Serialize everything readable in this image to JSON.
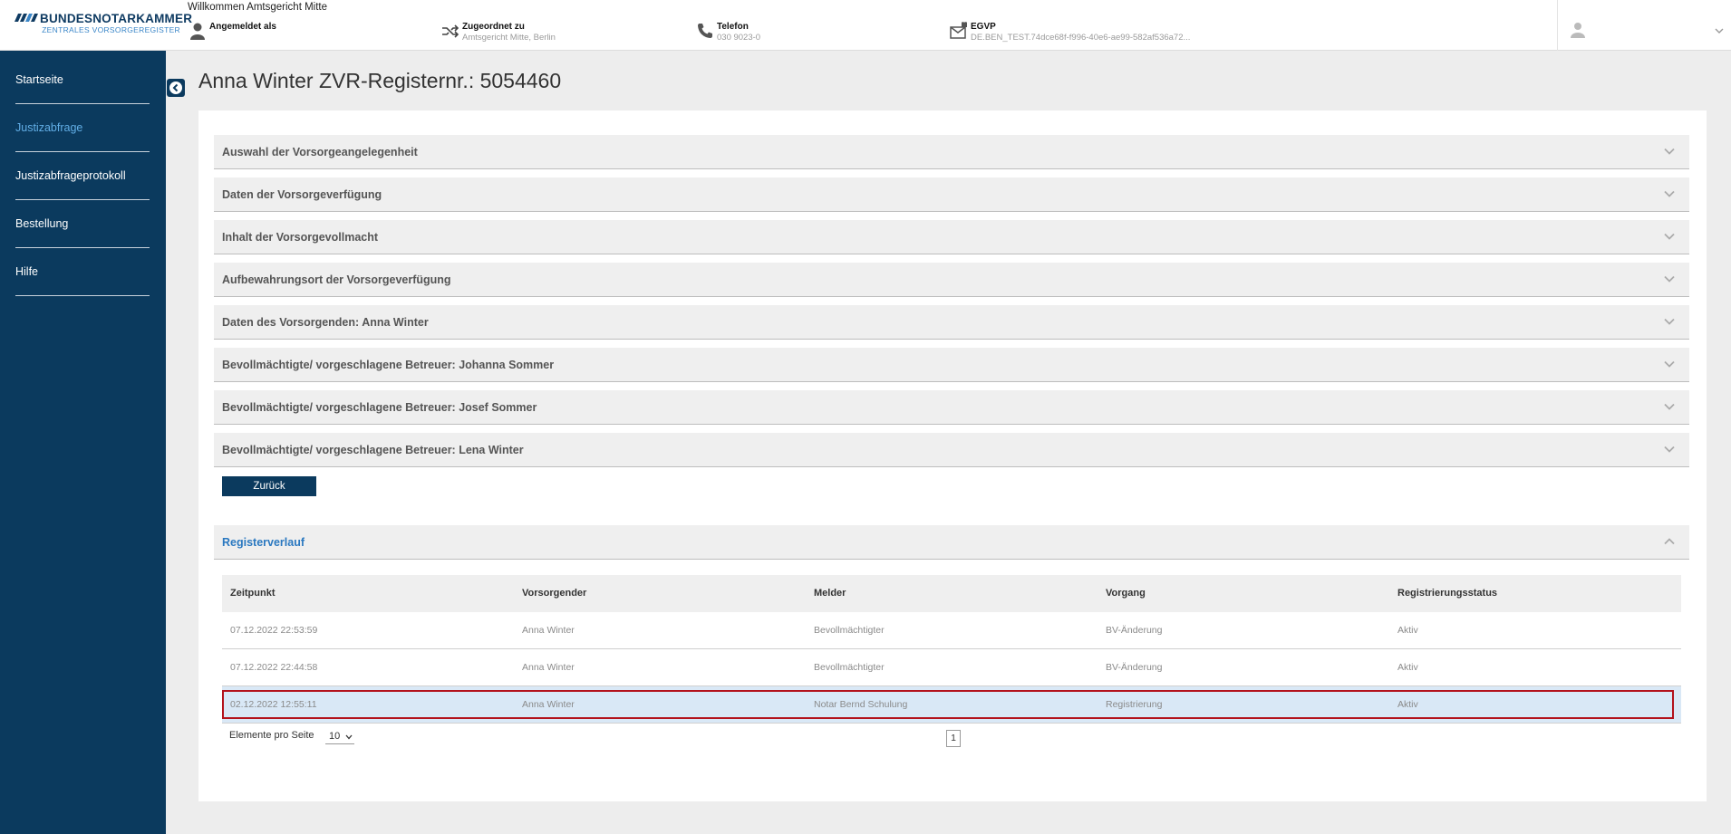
{
  "header": {
    "logo_name": "BUNDESNOTARKAMMER",
    "logo_sub": "ZENTRALES VORSORGEREGISTER",
    "welcome": "Willkommen Amtsgericht Mitte",
    "logged_in_label": "Angemeldet als",
    "assigned_label": "Zugeordnet zu",
    "assigned_value": "Amtsgericht Mitte, Berlin",
    "phone_label": "Telefon",
    "phone_value": "030 9023-0",
    "egvp_label": "EGVP",
    "egvp_value": "DE.BEN_TEST.74dce68f-f996-40e6-ae99-582af536a72..."
  },
  "sidebar": {
    "items": [
      {
        "label": "Startseite"
      },
      {
        "label": "Justizabfrage"
      },
      {
        "label": "Justizabfrageprotokoll"
      },
      {
        "label": "Bestellung"
      },
      {
        "label": "Hilfe"
      }
    ]
  },
  "page": {
    "title": "Anna Winter ZVR-Registernr.: 5054460"
  },
  "accordion": [
    {
      "label": "Auswahl der Vorsorgeangelegenheit"
    },
    {
      "label": "Daten der Vorsorgeverfügung"
    },
    {
      "label": "Inhalt der Vorsorgevollmacht"
    },
    {
      "label": "Aufbewahrungsort der Vorsorgeverfügung"
    },
    {
      "label": "Daten des Vorsorgenden: Anna Winter"
    },
    {
      "label": "Bevollmächtigte/ vorgeschlagene Betreuer: Johanna Sommer"
    },
    {
      "label": "Bevollmächtigte/ vorgeschlagene Betreuer: Josef Sommer"
    },
    {
      "label": "Bevollmächtigte/ vorgeschlagene Betreuer: Lena Winter"
    }
  ],
  "back_button": "Zurück",
  "register": {
    "title": "Registerverlauf",
    "columns": [
      "Zeitpunkt",
      "Vorsorgender",
      "Melder",
      "Vorgang",
      "Registrierungsstatus"
    ],
    "rows": [
      [
        "07.12.2022 22:53:59",
        "Anna Winter",
        "Bevollmächtigter",
        "BV-Änderung",
        "Aktiv"
      ],
      [
        "07.12.2022 22:44:58",
        "Anna Winter",
        "Bevollmächtigter",
        "BV-Änderung",
        "Aktiv"
      ],
      [
        "02.12.2022 12:55:11",
        "Anna Winter",
        "Notar Bernd Schulung",
        "Registrierung",
        "Aktiv"
      ]
    ],
    "selected_row": 2
  },
  "pager": {
    "label": "Elemente pro Seite",
    "per_page": "10",
    "page": "1"
  },
  "colors": {
    "navy": "#0b3a5e",
    "active_link": "#62aee6",
    "selected_row": "#d9e8f6",
    "selected_outline": "#b3121c"
  },
  "icons": [
    "user-icon",
    "shuffle-icon",
    "phone-icon",
    "mail-lock-icon",
    "chevron-down-icon",
    "chevron-up-icon",
    "chevron-left-icon"
  ]
}
